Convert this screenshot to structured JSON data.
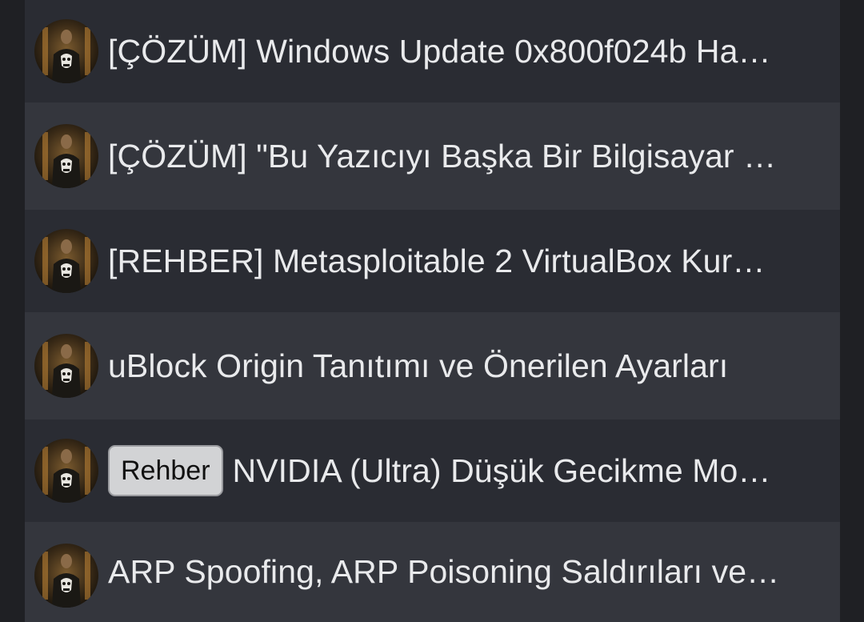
{
  "threads": [
    {
      "prefix": "",
      "title": "[ÇÖZÜM] Windows Update 0x800f024b Ha…",
      "avatar": "punisher-avatar"
    },
    {
      "prefix": "",
      "title": "[ÇÖZÜM] \"Bu Yazıcıyı Başka Bir Bilgisayar …",
      "avatar": "punisher-avatar"
    },
    {
      "prefix": "",
      "title": "[REHBER] Metasploitable 2 VirtualBox Kur…",
      "avatar": "punisher-avatar"
    },
    {
      "prefix": "",
      "title": "uBlock Origin Tanıtımı ve Önerilen Ayarları",
      "avatar": "punisher-avatar"
    },
    {
      "prefix": "Rehber",
      "title": "NVIDIA (Ultra) Düşük Gecikme Mo…",
      "avatar": "punisher-avatar"
    },
    {
      "prefix": "",
      "title": "ARP Spoofing, ARP Poisoning Saldırıları ve…",
      "avatar": "punisher-avatar"
    }
  ],
  "colors": {
    "page_bg": "#1f2024",
    "row_dark": "#2a2c33",
    "row_light": "#34363d",
    "text": "#e9eaec",
    "tag_bg": "#d2d3d5"
  }
}
